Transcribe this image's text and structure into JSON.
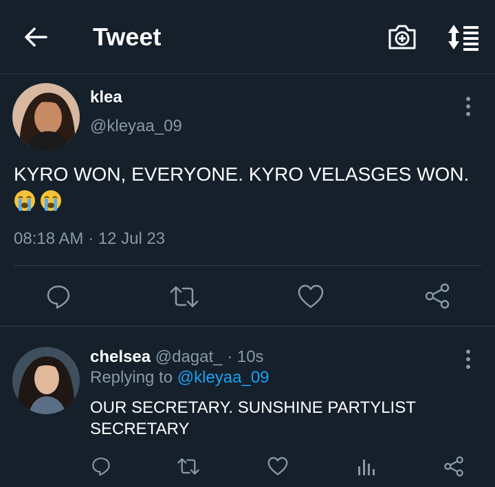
{
  "header": {
    "title": "Tweet",
    "back_icon": "arrow-left-icon",
    "camera_icon": "camera-plus-icon",
    "sort_icon": "sort-list-icon"
  },
  "tweet": {
    "author_name": "klea",
    "handle": "@kleyaa_09",
    "text": "KYRO WON, EVERYONE. KYRO VELASGES WON.",
    "emojis": [
      "loudly-crying-face",
      "loudly-crying-face"
    ],
    "timestamp": "08:18 AM · 12 Jul 23",
    "actions": [
      "reply-icon",
      "retweet-icon",
      "like-icon",
      "share-icon"
    ]
  },
  "reply": {
    "author_name": "chelsea",
    "handle_time": "@dagat_ · 10s",
    "replying_to_label": "Replying to ",
    "replying_to_handle": "@kleyaa_09",
    "text": "OUR SECRETARY. SUNSHINE PARTYLIST SECRETARY",
    "actions": [
      "reply-icon",
      "retweet-icon",
      "like-icon",
      "analytics-icon",
      "share-icon"
    ]
  },
  "colors": {
    "background": "#15202b",
    "secondary_text": "#8899a6",
    "link": "#1da1f2",
    "divider": "#38444d"
  }
}
